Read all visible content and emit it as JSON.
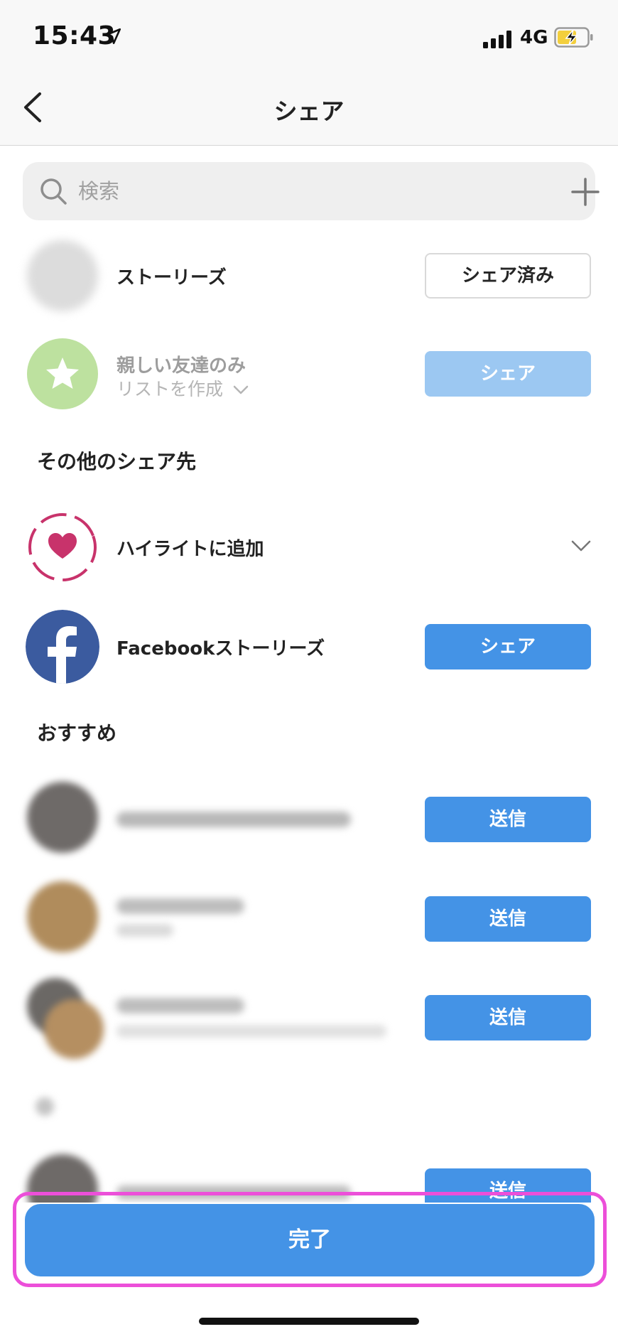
{
  "status_bar": {
    "time": "15:43",
    "network": "4G"
  },
  "header": {
    "title": "シェア"
  },
  "search": {
    "placeholder": "検索"
  },
  "stories": {
    "label": "ストーリーズ",
    "button": "シェア済み"
  },
  "close_friends": {
    "label": "親しい友達のみ",
    "sublabel": "リストを作成",
    "button": "シェア"
  },
  "other_section": {
    "title": "その他のシェア先"
  },
  "highlight": {
    "label": "ハイライトに追加"
  },
  "facebook": {
    "label": "Facebookストーリーズ",
    "button": "シェア"
  },
  "recommended": {
    "title": "おすすめ",
    "send_label": "送信"
  },
  "footer": {
    "done": "完了"
  },
  "colors": {
    "accent": "#4493e6",
    "highlight_pink": "#c8336b",
    "facebook": "#3b5b9f",
    "close_friends_green": "#a8d77f"
  }
}
